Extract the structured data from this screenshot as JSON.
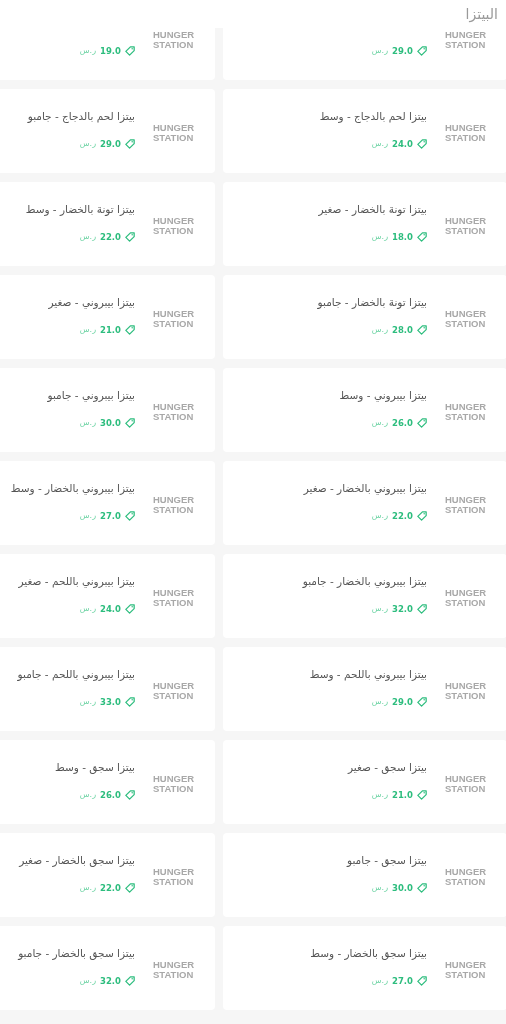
{
  "section_title": "البيتزا",
  "items": [
    {
      "price": "29.0",
      "currency": "ر.س",
      "logo": "HUNGER STATION"
    },
    {
      "price": "19.0",
      "currency": "ر.س",
      "logo": "HUNGER STATION"
    },
    {
      "name": "بيتزا لحم بالدجاج - وسط",
      "price": "24.0",
      "currency": "ر.س",
      "logo": "HUNGER STATION"
    },
    {
      "name": "بيتزا لحم بالدجاج - جامبو",
      "price": "29.0",
      "currency": "ر.س",
      "logo": "HUNGER STATION"
    },
    {
      "name": "بيتزا تونة بالخضار - صغير",
      "price": "18.0",
      "currency": "ر.س",
      "logo": "HUNGER STATION"
    },
    {
      "name": "بيتزا تونة بالخضار - وسط",
      "price": "22.0",
      "currency": "ر.س",
      "logo": "HUNGER STATION"
    },
    {
      "name": "بيتزا تونة بالخضار - جامبو",
      "price": "28.0",
      "currency": "ر.س",
      "logo": "HUNGER STATION"
    },
    {
      "name": "بيتزا بيبروني - صغير",
      "price": "21.0",
      "currency": "ر.س",
      "logo": "HUNGER STATION"
    },
    {
      "name": "بيتزا بيبروني - وسط",
      "price": "26.0",
      "currency": "ر.س",
      "logo": "HUNGER STATION"
    },
    {
      "name": "بيتزا بيبروني - جامبو",
      "price": "30.0",
      "currency": "ر.س",
      "logo": "HUNGER STATION"
    },
    {
      "name": "بيتزا بيبروني بالخضار - صغير",
      "price": "22.0",
      "currency": "ر.س",
      "logo": "HUNGER STATION"
    },
    {
      "name": "بيتزا بيبروني بالخضار - وسط",
      "price": "27.0",
      "currency": "ر.س",
      "logo": "HUNGER STATION"
    },
    {
      "name": "بيتزا بيبروني بالخضار - جامبو",
      "price": "32.0",
      "currency": "ر.س",
      "logo": "HUNGER STATION"
    },
    {
      "name": "بيتزا بيبروني باللحم - صغير",
      "price": "24.0",
      "currency": "ر.س",
      "logo": "HUNGER STATION"
    },
    {
      "name": "بيتزا بيبروني باللحم - وسط",
      "price": "29.0",
      "currency": "ر.س",
      "logo": "HUNGER STATION"
    },
    {
      "name": "بيتزا بيبروني باللحم - جامبو",
      "price": "33.0",
      "currency": "ر.س",
      "logo": "HUNGER STATION"
    },
    {
      "name": "بيتزا سجق - صغير",
      "price": "21.0",
      "currency": "ر.س",
      "logo": "HUNGER STATION"
    },
    {
      "name": "بيتزا سجق - وسط",
      "price": "26.0",
      "currency": "ر.س",
      "logo": "HUNGER STATION"
    },
    {
      "name": "بيتزا سجق - جامبو",
      "price": "30.0",
      "currency": "ر.س",
      "logo": "HUNGER STATION"
    },
    {
      "name": "بيتزا سجق بالخضار - صغير",
      "price": "22.0",
      "currency": "ر.س",
      "logo": "HUNGER STATION"
    },
    {
      "name": "بيتزا سجق بالخضار - وسط",
      "price": "27.0",
      "currency": "ر.س",
      "logo": "HUNGER STATION"
    },
    {
      "name": "بيتزا سجق بالخضار - جامبو",
      "price": "32.0",
      "currency": "ر.س",
      "logo": "HUNGER STATION"
    }
  ]
}
